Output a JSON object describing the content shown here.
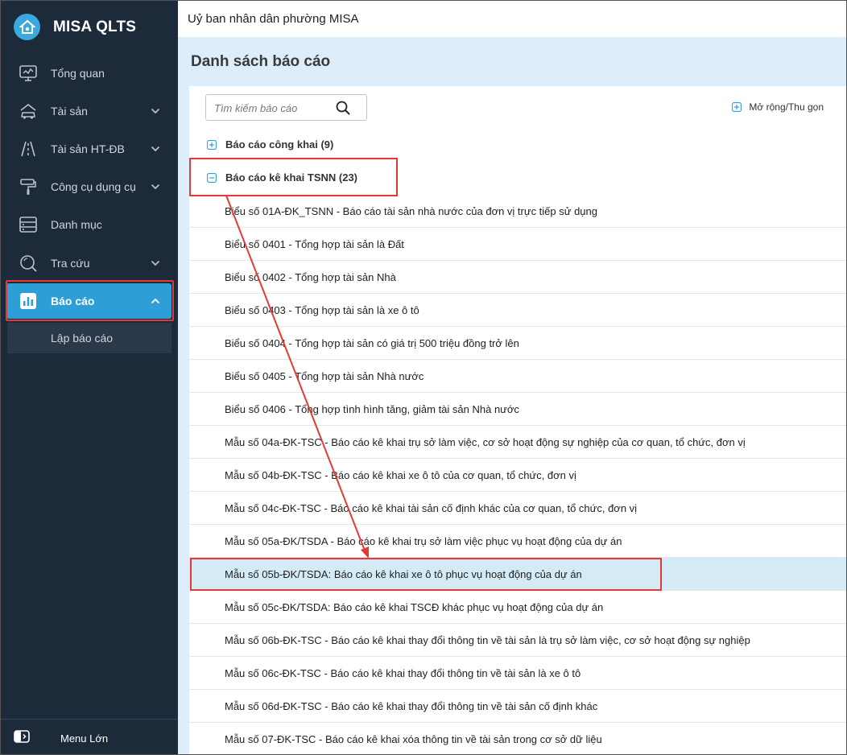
{
  "app": {
    "name": "MISA QLTS"
  },
  "sidebar": {
    "items": [
      {
        "label": "Tổng quan",
        "icon": "monitor-icon"
      },
      {
        "label": "Tài sản",
        "icon": "car-house-icon"
      },
      {
        "label": "Tài sản HT-ĐB",
        "icon": "road-icon"
      },
      {
        "label": "Công cụ dụng cụ",
        "icon": "paint-roller-icon"
      },
      {
        "label": "Danh mục",
        "icon": "list-icon"
      },
      {
        "label": "Tra cứu",
        "icon": "search-icon"
      },
      {
        "label": "Báo cáo",
        "icon": "bar-chart-icon"
      }
    ],
    "sub_item": "Lập báo cáo",
    "bottom_label": "Menu Lớn"
  },
  "topbar": {
    "org": "Uỷ ban nhân dân phường MISA"
  },
  "main": {
    "title": "Danh sách báo cáo",
    "search_placeholder": "Tìm kiếm báo cáo",
    "expand_label": "Mở rộng/Thu gọn",
    "groups": [
      {
        "label": "Báo cáo công khai (9)",
        "state": "collapsed"
      },
      {
        "label": "Báo cáo kê khai TSNN (23)",
        "state": "expanded"
      }
    ],
    "reports": [
      "Biểu số 01A-ĐK_TSNN - Báo cáo tài sản nhà nước của đơn vị trực tiếp sử dụng",
      "Biểu số 0401 - Tổng hợp tài sản là Đất",
      "Biểu số 0402 - Tổng hợp tài sản Nhà",
      "Biểu số 0403 - Tổng hợp tài sản là xe ô tô",
      "Biểu số 0404 - Tổng hợp tài sản có giá trị 500 triệu đồng trở lên",
      "Biểu số 0405 - Tổng hợp tài sản Nhà nước",
      "Biểu số 0406 - Tổng hợp tình hình tăng, giảm tài sản Nhà nước",
      "Mẫu số 04a-ĐK-TSC - Báo cáo kê khai trụ sở làm việc, cơ sở hoạt động sự nghiệp của cơ quan, tổ chức, đơn vị",
      "Mẫu số 04b-ĐK-TSC - Báo cáo kê khai xe ô tô của cơ quan, tổ chức, đơn vị",
      "Mẫu số 04c-ĐK-TSC - Báo cáo kê khai tài sản cố định khác của cơ quan, tổ chức, đơn vị",
      "Mẫu số 05a-ĐK/TSDA - Báo cáo kê khai trụ sở làm việc phục vụ hoạt động của dự án",
      "Mẫu số 05b-ĐK/TSDA: Báo cáo kê khai xe ô tô phục vụ hoạt động của dự án",
      "Mẫu số 05c-ĐK/TSDA: Báo cáo kê khai TSCĐ khác phục vụ hoạt động của dự án",
      "Mẫu số 06b-ĐK-TSC - Báo cáo kê khai thay đổi thông tin về tài sản là trụ sở làm việc, cơ sở hoạt động sự nghiệp",
      "Mẫu số 06c-ĐK-TSC - Báo cáo kê khai thay đổi thông tin về tài sản là xe ô tô",
      "Mẫu số 06d-ĐK-TSC - Báo cáo kê khai thay đổi thông tin về tài sản cố định khác",
      "Mẫu số 07-ĐK-TSC - Báo cáo kê khai xóa thông tin về tài sản trong cơ sở dữ liệu"
    ],
    "highlighted_report_index": 11
  },
  "colors": {
    "sidebar_bg": "#1d2a3a",
    "accent": "#2d9fd6",
    "content_bg": "#ddeefa",
    "highlight_row": "#d4ebf6",
    "annotation_red": "#e53935"
  }
}
